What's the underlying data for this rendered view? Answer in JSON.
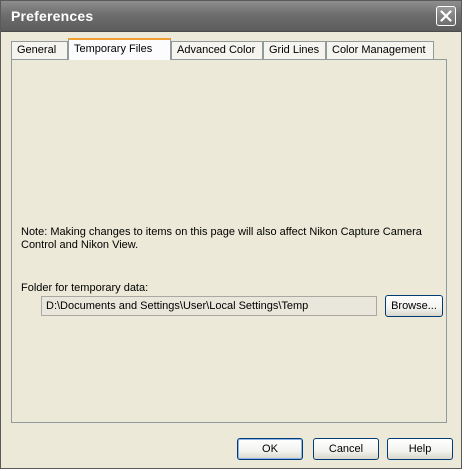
{
  "window": {
    "title": "Preferences",
    "close_icon": "close-icon"
  },
  "tabs": [
    {
      "label": "General",
      "active": false
    },
    {
      "label": "Temporary Files",
      "active": true
    },
    {
      "label": "Advanced Color",
      "active": false
    },
    {
      "label": "Grid Lines",
      "active": false
    },
    {
      "label": "Color Management",
      "active": false
    }
  ],
  "panel": {
    "note": "Note: Making changes to items on this page will also affect Nikon Capture Camera Control and Nikon View.",
    "folder_label": "Folder for temporary data:",
    "folder_path": "D:\\Documents and Settings\\User\\Local Settings\\Temp",
    "browse_label": "Browse..."
  },
  "buttons": {
    "ok": "OK",
    "cancel": "Cancel",
    "help": "Help"
  },
  "colors": {
    "title_bar": "#6e6e6e",
    "dialog_face": "#ece9d8",
    "active_tab_highlight": "#f0a030",
    "button_border": "#003c74"
  }
}
